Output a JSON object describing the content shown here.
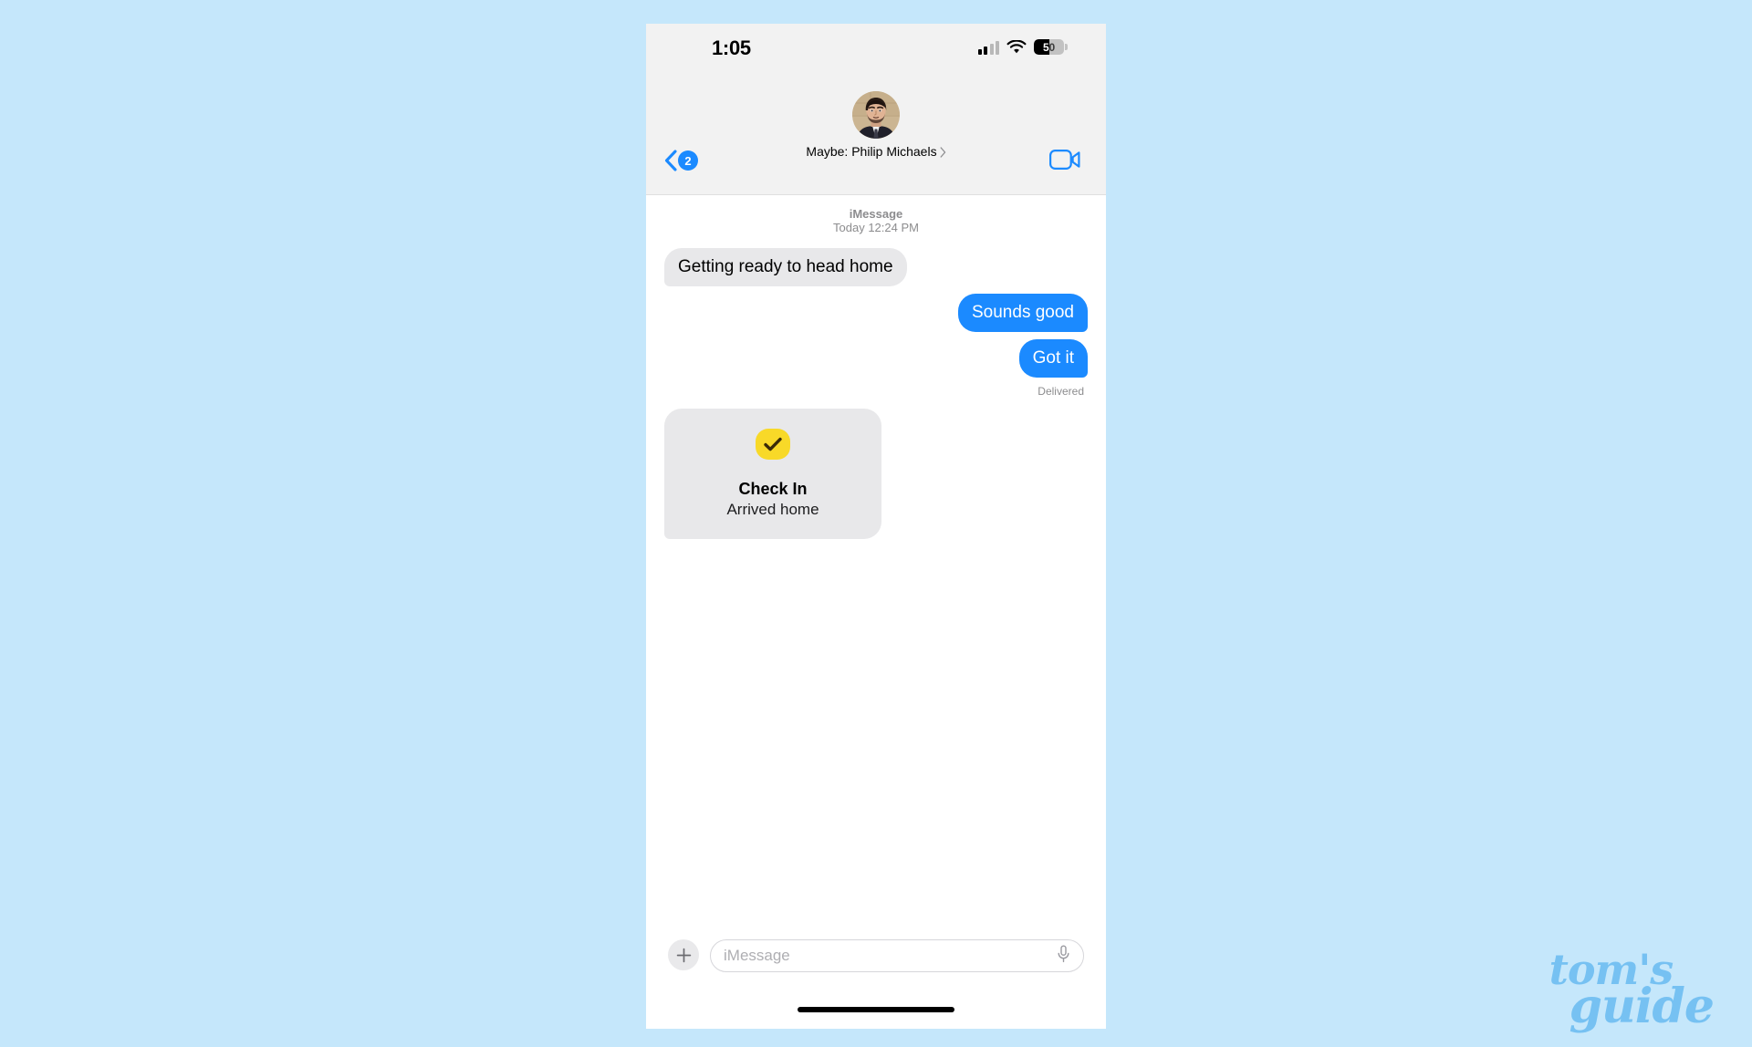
{
  "background_color": "#c5e7fb",
  "status_bar": {
    "time": "1:05",
    "battery_percent": "50",
    "battery_level": 50,
    "cellular_bars": 2,
    "wifi": "wifi-icon"
  },
  "nav_header": {
    "back_badge": "2",
    "contact_name": "Maybe: Philip Michaels",
    "disclosure": "›",
    "facetime_label": "FaceTime"
  },
  "conversation": {
    "service": "iMessage",
    "timestamp": "Today 12:24 PM",
    "messages": [
      {
        "direction": "in",
        "text": "Getting ready to head home"
      },
      {
        "direction": "out",
        "text": "Sounds good"
      },
      {
        "direction": "out",
        "text": "Got it"
      }
    ],
    "delivery_status": "Delivered",
    "check_in": {
      "title": "Check In",
      "subtitle": "Arrived home",
      "icon": "checkmark-icon",
      "icon_color": "#f8d928"
    }
  },
  "input_bar": {
    "add_label": "+",
    "placeholder": "iMessage",
    "value": "",
    "mic": "microphone-icon"
  },
  "watermark": {
    "line1": "tom's",
    "line2": "guide",
    "color": "#76c1f2"
  },
  "colors": {
    "outgoing_bubble": "#1b8aff",
    "incoming_bubble": "#e8e8ea",
    "header_bg": "#f2f2f2",
    "accent": "#1b8aff"
  }
}
